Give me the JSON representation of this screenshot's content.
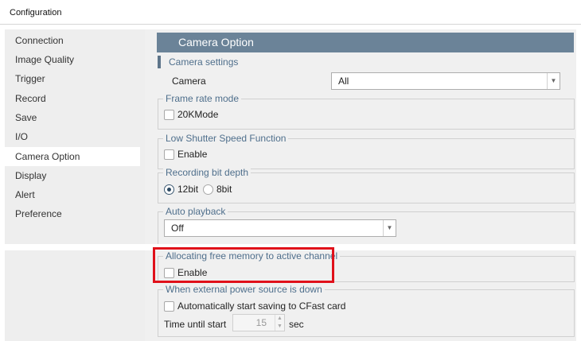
{
  "window": {
    "title": "Configuration"
  },
  "sidebar": {
    "items": [
      {
        "label": "Connection",
        "selected": false
      },
      {
        "label": "Image Quality",
        "selected": false
      },
      {
        "label": "Trigger",
        "selected": false
      },
      {
        "label": "Record",
        "selected": false
      },
      {
        "label": "Save",
        "selected": false
      },
      {
        "label": "I/O",
        "selected": false
      },
      {
        "label": "Camera Option",
        "selected": true
      },
      {
        "label": "Display",
        "selected": false
      },
      {
        "label": "Alert",
        "selected": false
      },
      {
        "label": "Preference",
        "selected": false
      }
    ]
  },
  "main": {
    "header": "Camera Option",
    "section": "Camera settings",
    "camera": {
      "label": "Camera",
      "value": "All"
    },
    "frame_rate_mode": {
      "legend": "Frame rate mode",
      "option": "20KMode",
      "checked": false
    },
    "low_shutter": {
      "legend": "Low Shutter Speed Function",
      "option": "Enable",
      "checked": false
    },
    "bit_depth": {
      "legend": "Recording bit depth",
      "options": [
        "12bit",
        "8bit"
      ],
      "selected": "12bit"
    },
    "auto_playback": {
      "legend": "Auto playback",
      "value": "Off"
    },
    "alloc_memory": {
      "legend": "Allocating free memory to active channel",
      "option": "Enable",
      "checked": false
    },
    "power_down": {
      "legend": "When external power source is down",
      "option": "Automatically start saving to CFast card",
      "checked": false,
      "time_label": "Time until start",
      "time_value": "15",
      "time_unit": "sec"
    }
  },
  "colors": {
    "header_bg": "#6b8398",
    "accent_text": "#4f6f8c",
    "highlight": "#e0101a",
    "sidebar_bg": "#eeeeee",
    "content_bg": "#f0f0f0"
  }
}
